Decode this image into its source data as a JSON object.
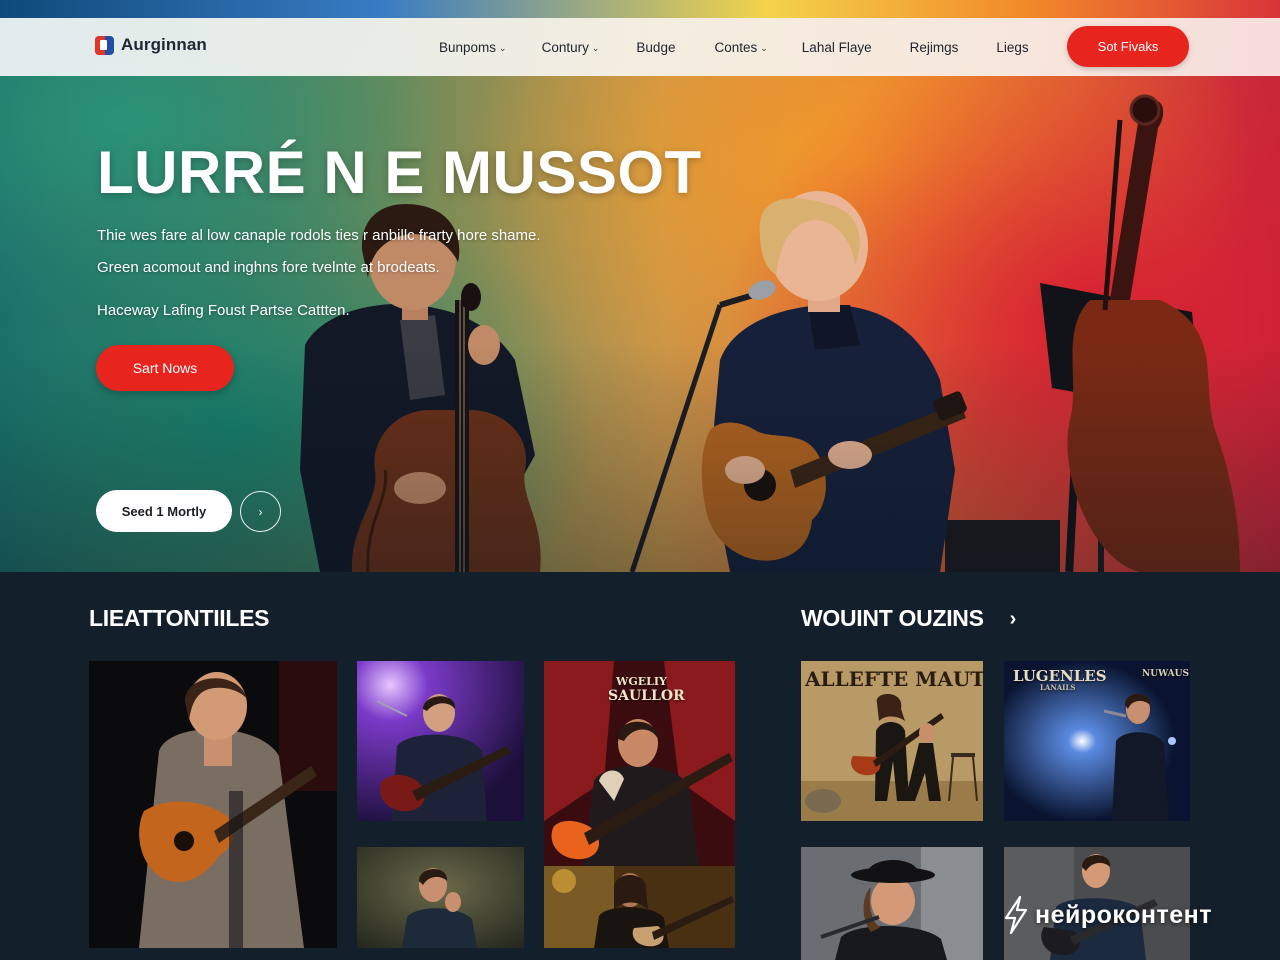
{
  "brand": {
    "name": "Aurginnan"
  },
  "nav": {
    "items": [
      {
        "label": "Bunpoms",
        "dropdown": true
      },
      {
        "label": "Contury",
        "dropdown": true
      },
      {
        "label": "Budge",
        "dropdown": false
      },
      {
        "label": "Contes",
        "dropdown": true
      },
      {
        "label": "Lahal Flaye",
        "dropdown": false
      },
      {
        "label": "Rejimgs",
        "dropdown": false
      },
      {
        "label": "Liegs",
        "dropdown": false
      }
    ],
    "cta_label": "Sot Fivaks"
  },
  "hero": {
    "title": "LURRÉ N E MUSSOT",
    "line1": "Thie wes fare al low canaple rodols ties r anbillc frarty hore shame.",
    "line2": "Green acomout and inghns fore tvelnte at brodeats.",
    "line3": "Haceway Lafing Foust Partse Cattten.",
    "primary_button": "Sart Nows",
    "secondary_button": "Seed 1 Mortly",
    "play_icon": "›"
  },
  "sections": {
    "left_title": "LIEATTONTIILES",
    "right_title": "WOUINT OUZINS",
    "right_arrow": "›"
  },
  "tiles": {
    "t3_caption_line1": "WGELIY",
    "t3_caption_line2": "SAULLOR",
    "t6_caption": "ALLEFTE MAUTERS",
    "t7_caption_left": "LUGENLES",
    "t7_caption_left_sub": "LANAILS",
    "t7_caption_right": "NUWAUS"
  },
  "watermark": {
    "text": "нейроконтент"
  },
  "colors": {
    "accent_red": "#e8241f",
    "page_dark": "#13202c",
    "nav_text": "#1e2530"
  }
}
